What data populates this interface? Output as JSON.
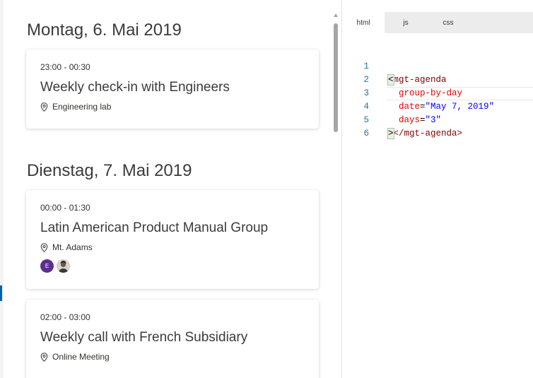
{
  "agenda": {
    "days": [
      {
        "header": "Montag, 6. Mai 2019",
        "events": [
          {
            "time": "23:00 - 00:30",
            "subject": "Weekly check-in with Engineers",
            "location": "Engineering lab",
            "attendees": []
          }
        ]
      },
      {
        "header": "Dienstag, 7. Mai 2019",
        "events": [
          {
            "time": "00:00 - 01:30",
            "subject": "Latin American Product Manual Group",
            "location": "Mt. Adams",
            "attendees": [
              "E",
              "photo"
            ]
          },
          {
            "time": "02:00 - 03:00",
            "subject": "Weekly call with French Subsidiary",
            "location": "Online Meeting",
            "attendees": []
          }
        ]
      }
    ]
  },
  "editor": {
    "tabs": [
      {
        "label": "html",
        "active": true
      },
      {
        "label": "js",
        "active": false
      },
      {
        "label": "css",
        "active": false
      }
    ],
    "line_numbers": [
      "1",
      "2",
      "3",
      "4",
      "5",
      "6"
    ],
    "code": {
      "l1_open": "<",
      "l1_tag": "mgt-agenda",
      "l2_attr": "group-by-day",
      "l3_attr": "date",
      "l3_eq": "=",
      "l3_val": "\"May 7, 2019\"",
      "l4_attr": "days",
      "l4_eq": "=",
      "l4_val": "\"3\"",
      "l5_close": ">",
      "l5_tag": "</mgt-agenda>"
    }
  },
  "colors": {
    "accent": "#0063b1",
    "avatar_initial_bg": "#5c2e91",
    "code_tag": "#800000",
    "code_attr": "#e50000",
    "code_string": "#0000ff",
    "line_number": "#237893"
  },
  "icons": {
    "location": "map-pin-icon"
  }
}
